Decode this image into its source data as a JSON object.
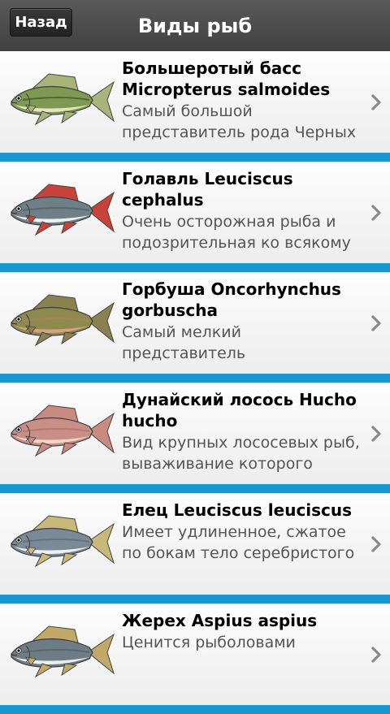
{
  "header": {
    "back_label": "Назад",
    "title": "Виды рыб"
  },
  "accent_color": "#1797cf",
  "items": [
    {
      "title": "Большеротый басс Micropterus salmoides",
      "description": "Самый большой представитель рода Черных",
      "icon": "largemouth-bass-icon",
      "colors": {
        "body": "#7e9a52",
        "belly": "#e7e2c2",
        "fin": "#a9b47a",
        "stripe": "#3f4f2a"
      }
    },
    {
      "title": "Голавль Leuciscus cephalus",
      "description": "Очень осторожная рыба и подозрительная ко всякому",
      "icon": "chub-icon",
      "colors": {
        "body": "#6f7f87",
        "belly": "#eef0ef",
        "fin": "#c7433a",
        "stripe": "#4f5d64"
      }
    },
    {
      "title": "Горбуша Oncorhynchus gorbuscha",
      "description": "Самый мелкий представитель",
      "icon": "pink-salmon-icon",
      "colors": {
        "body": "#8d8a4e",
        "belly": "#d9a27e",
        "fin": "#8b8150",
        "stripe": "#b77a63"
      }
    },
    {
      "title": "Дунайский лосось Hucho hucho",
      "description": "Вид крупных лососевых рыб, вываживание которого",
      "icon": "danube-salmon-icon",
      "colors": {
        "body": "#c98f85",
        "belly": "#f0d4cb",
        "fin": "#c98a80",
        "stripe": "#a86f66"
      }
    },
    {
      "title": "Елец Leuciscus leuciscus",
      "description": "Имеет удлиненное, сжатое по бокам тело серебристого",
      "icon": "dace-icon",
      "colors": {
        "body": "#7b8a98",
        "belly": "#eef1f3",
        "fin": "#c8b87a",
        "stripe": "#5a6876"
      }
    },
    {
      "title": "Жерех Aspius aspius",
      "description": "Ценится рыболовами",
      "icon": "asp-icon",
      "colors": {
        "body": "#6e7c86",
        "belly": "#eceeee",
        "fin": "#c1a968",
        "stripe": "#505c64"
      }
    }
  ]
}
